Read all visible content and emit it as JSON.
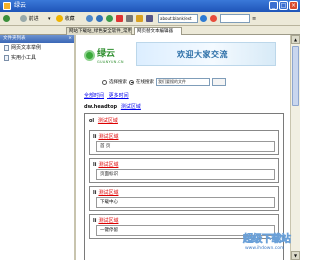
{
  "window": {
    "title": "绿云"
  },
  "toolbar": {
    "forward_label": "前进",
    "search_label": "收藏",
    "address_value": "about:blank/ext"
  },
  "tabs": [
    {
      "label": "网站下载站_绿色安全软件_常用"
    },
    {
      "label": "网页替文本编辑器"
    }
  ],
  "sidebar": {
    "header": "文件夹列表",
    "items": [
      {
        "label": "网页文本举例"
      },
      {
        "label": "实用小工具"
      }
    ]
  },
  "page": {
    "logo_name": "绿云",
    "logo_sub": "GUANYUN.CN",
    "banner_text": "欢迎大家交流",
    "search": {
      "option1": "选择搜索",
      "option2": "在线搜索",
      "input_value": "我们要搜的文件"
    },
    "links": [
      "全部时间",
      "更多时间"
    ],
    "dir_label": "dw.headtop",
    "dir_link": "测试区域",
    "outer_label": "ol",
    "outer_link": "测试区域",
    "boxes": [
      {
        "label": "li",
        "link": "测试区域",
        "inner": "首 页"
      },
      {
        "label": "li",
        "link": "测试区域",
        "inner": "页面标识"
      },
      {
        "label": "li",
        "link": "测试区域",
        "inner": "下载中心"
      },
      {
        "label": "li",
        "link": "测试区域",
        "inner": "一键停留"
      }
    ]
  },
  "watermark": {
    "main": "超级下载站",
    "url": "www.ihdown.com"
  }
}
